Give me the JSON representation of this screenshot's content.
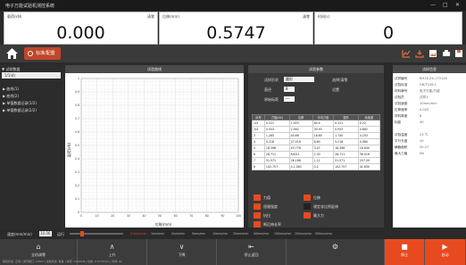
{
  "window": {
    "title": "电子万能试验机测控系统",
    "controls": [
      "—",
      "□",
      "✕"
    ]
  },
  "readouts": [
    {
      "label": "载荷(kN)",
      "unit": "清零",
      "value": "0.000"
    },
    {
      "label": "位移(mm)",
      "unit": "清零",
      "value": "0.5747"
    },
    {
      "label": "时间(s)",
      "unit": "",
      "value": "0"
    }
  ],
  "nav": {
    "badge": "标准/配置",
    "icons": [
      "chart-icon",
      "export-icon",
      "image-icon",
      "print-icon",
      "save-icon"
    ]
  },
  "sidebar": {
    "header": "▼ 试样数据",
    "selected": "1/1(4)",
    "items": [
      "▶ 曲线(1)",
      "▶ 曲线(2)",
      "▶ 单值数据记录(1/2)",
      "▶ 单值数据记录(2/2)"
    ]
  },
  "chart_panel": {
    "title": "试验曲线"
  },
  "chart_data": {
    "type": "line",
    "title": "",
    "xlabel": "位移(mm)",
    "ylabel": "载荷(kN)",
    "x_ticks": [
      "0",
      "10",
      "20",
      "30",
      "40",
      "50",
      "60",
      "70",
      "80",
      "90",
      "100"
    ],
    "y_ticks": [
      "0",
      "0.1",
      "0.2",
      "0.3",
      "0.4",
      "0.5",
      "0.6",
      "0.7",
      "0.8",
      "0.9",
      "1"
    ],
    "series": [],
    "grid": true
  },
  "params_panel": {
    "title": "试验参数",
    "form": [
      {
        "label": "试样形状",
        "value": "圆形"
      },
      {
        "label": "直径",
        "value": "8"
      },
      {
        "label": "原始标距",
        "value": "—"
      }
    ],
    "buttons": [
      "选择/清零",
      "设置"
    ],
    "table_headers": [
      "序号",
      "力值(kN)",
      "位移",
      "平均力值",
      "变形",
      "标准差",
      "方差",
      "变异系数"
    ],
    "rows": [
      [
        "1/4",
        "0.221",
        "1.003",
        "60.4",
        "0.221",
        "0.22"
      ],
      [
        "2/4",
        "0.553",
        "2.562",
        "30.93",
        "0.553",
        "0.862"
      ],
      [
        "3",
        "1.265",
        "40.66",
        "18.69",
        "1.740",
        "4.203"
      ],
      [
        "4",
        "5.218",
        "27.019",
        "8.60",
        "5.218",
        "4.980"
      ],
      [
        "5",
        "18.398",
        "43.778",
        "3.47",
        "18.398",
        "16.640"
      ],
      [
        "6",
        "28.711",
        "$4011",
        "2.30",
        "28.711",
        "36.016"
      ],
      [
        "7",
        "51.571",
        "26.168",
        "1.11",
        "51.571",
        "207.09"
      ],
      [
        "8",
        "102.757",
        "4.1.063",
        "0.2",
        "102.757",
        "41.830"
      ]
    ],
    "legend": [
      {
        "label": "力值",
        "color": "#e84a1f"
      },
      {
        "label": "位移",
        "color": "#e84a1f"
      },
      {
        "label": "屈服强度",
        "color": "#e84a1f"
      },
      {
        "label": "规定非比例延伸",
        "color": "#222222"
      },
      {
        "label": "抗拉",
        "color": "#e84a1f"
      },
      {
        "label": "最大力",
        "color": "#e84a1f"
      },
      {
        "label": "断后伸长率",
        "color": "#e84a1f"
      }
    ]
  },
  "info_panel": {
    "title": "试样信息",
    "rows": [
      [
        "试样编号",
        "BH18-ZX-170128"
      ],
      [
        "试验标准",
        "GB/T228.1"
      ],
      [
        "材料牌号",
        "电子万能/万能"
      ],
      [
        "试验员",
        "试样1"
      ],
      [
        "试验速度",
        "10mm/min"
      ],
      [
        "拉伸速率",
        "0.025"
      ],
      [
        "材料厚度",
        "8"
      ],
      [
        "标距",
        "40"
      ],
      [
        "",
        ""
      ],
      [
        "试验温度",
        "23 ℃"
      ],
      [
        "平行长度",
        "10"
      ],
      [
        "横截面积",
        "50.27"
      ],
      [
        "最大力值",
        "kN"
      ]
    ]
  },
  "slider": {
    "label": "速度(mm/min)",
    "value": "10.00",
    "button": "运行",
    "presets": [
      "0.5mm/min",
      "1mm/min",
      "2mm/min",
      "5mm/min",
      "10mm/min",
      "20mm/min",
      "50mm/min",
      "100mm/min",
      "200mm/min",
      "500mm/min"
    ]
  },
  "bottom_buttons": [
    {
      "label": "全机调零",
      "icon": "⌂"
    },
    {
      "label": "上升",
      "icon": "∧"
    },
    {
      "label": "下降",
      "icon": "∨"
    },
    {
      "label": "停止返回",
      "icon": "⇤"
    },
    {
      "label": "",
      "icon": "⚙"
    },
    {
      "label": "停止",
      "icon": "■"
    },
    {
      "label": "启动",
      "icon": "▶"
    }
  ],
  "status": "联机状态: 正常 | 通讯端口: COM3 | 试验状态: 准备 | 载荷: 0.000kN | 位移: 0.5747mm | 时间: 0s"
}
